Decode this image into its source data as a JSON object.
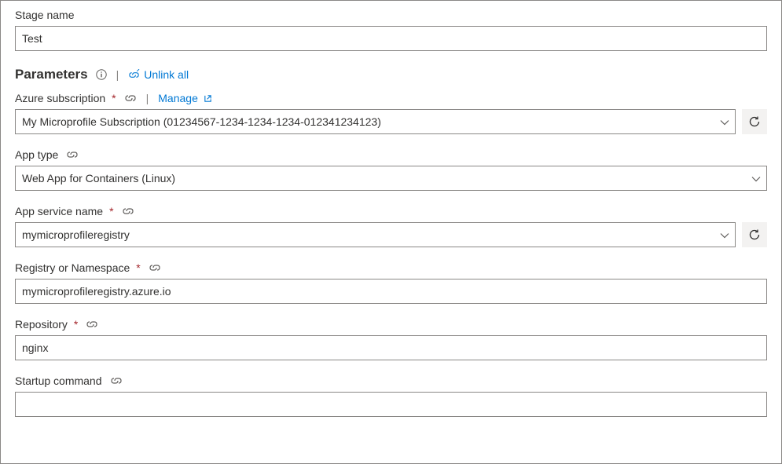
{
  "stageName": {
    "label": "Stage name",
    "value": "Test"
  },
  "parameters": {
    "title": "Parameters",
    "unlinkAll": "Unlink all"
  },
  "azureSubscription": {
    "label": "Azure subscription",
    "manage": "Manage",
    "value": "My Microprofile Subscription (01234567-1234-1234-1234-012341234123)"
  },
  "appType": {
    "label": "App type",
    "value": "Web App for Containers (Linux)"
  },
  "appServiceName": {
    "label": "App service name",
    "value": "mymicroprofileregistry"
  },
  "registryNamespace": {
    "label": "Registry or Namespace",
    "value": "mymicroprofileregistry.azure.io"
  },
  "repository": {
    "label": "Repository",
    "value": "nginx"
  },
  "startupCommand": {
    "label": "Startup command",
    "value": ""
  }
}
